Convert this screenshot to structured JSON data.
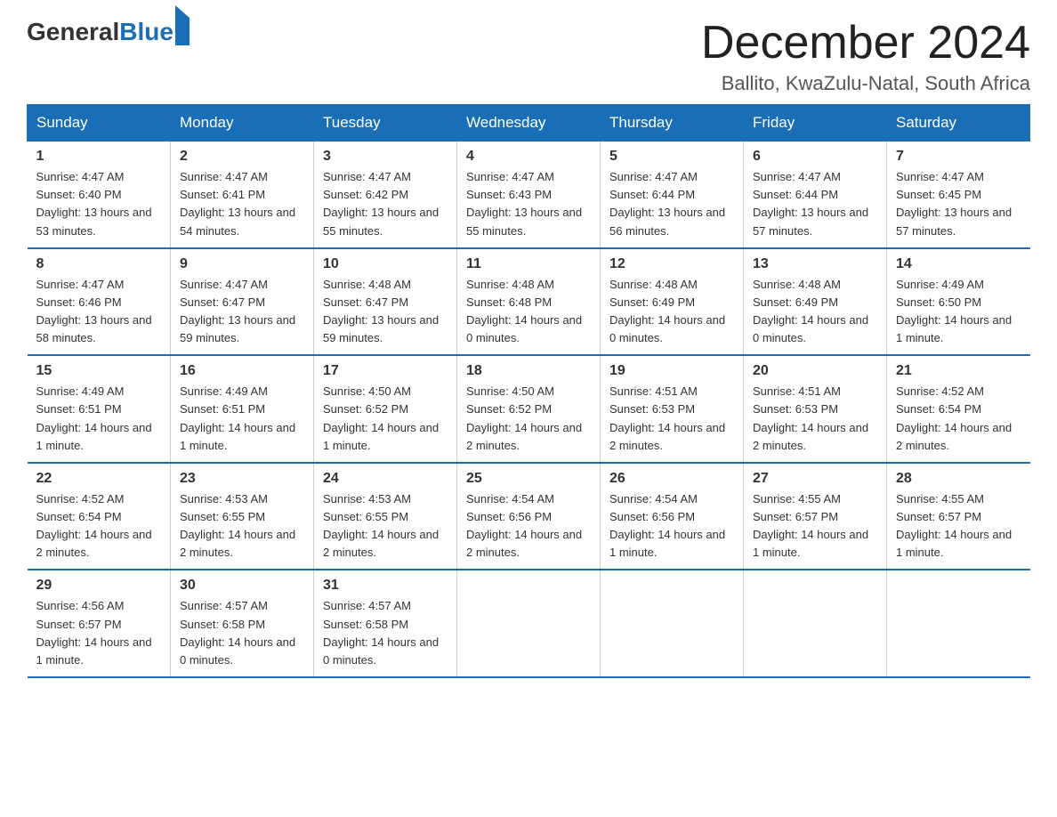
{
  "header": {
    "logo_general": "General",
    "logo_blue": "Blue",
    "month_title": "December 2024",
    "location": "Ballito, KwaZulu-Natal, South Africa"
  },
  "weekdays": [
    "Sunday",
    "Monday",
    "Tuesday",
    "Wednesday",
    "Thursday",
    "Friday",
    "Saturday"
  ],
  "weeks": [
    [
      {
        "day": "1",
        "sunrise": "4:47 AM",
        "sunset": "6:40 PM",
        "daylight": "13 hours and 53 minutes."
      },
      {
        "day": "2",
        "sunrise": "4:47 AM",
        "sunset": "6:41 PM",
        "daylight": "13 hours and 54 minutes."
      },
      {
        "day": "3",
        "sunrise": "4:47 AM",
        "sunset": "6:42 PM",
        "daylight": "13 hours and 55 minutes."
      },
      {
        "day": "4",
        "sunrise": "4:47 AM",
        "sunset": "6:43 PM",
        "daylight": "13 hours and 55 minutes."
      },
      {
        "day": "5",
        "sunrise": "4:47 AM",
        "sunset": "6:44 PM",
        "daylight": "13 hours and 56 minutes."
      },
      {
        "day": "6",
        "sunrise": "4:47 AM",
        "sunset": "6:44 PM",
        "daylight": "13 hours and 57 minutes."
      },
      {
        "day": "7",
        "sunrise": "4:47 AM",
        "sunset": "6:45 PM",
        "daylight": "13 hours and 57 minutes."
      }
    ],
    [
      {
        "day": "8",
        "sunrise": "4:47 AM",
        "sunset": "6:46 PM",
        "daylight": "13 hours and 58 minutes."
      },
      {
        "day": "9",
        "sunrise": "4:47 AM",
        "sunset": "6:47 PM",
        "daylight": "13 hours and 59 minutes."
      },
      {
        "day": "10",
        "sunrise": "4:48 AM",
        "sunset": "6:47 PM",
        "daylight": "13 hours and 59 minutes."
      },
      {
        "day": "11",
        "sunrise": "4:48 AM",
        "sunset": "6:48 PM",
        "daylight": "14 hours and 0 minutes."
      },
      {
        "day": "12",
        "sunrise": "4:48 AM",
        "sunset": "6:49 PM",
        "daylight": "14 hours and 0 minutes."
      },
      {
        "day": "13",
        "sunrise": "4:48 AM",
        "sunset": "6:49 PM",
        "daylight": "14 hours and 0 minutes."
      },
      {
        "day": "14",
        "sunrise": "4:49 AM",
        "sunset": "6:50 PM",
        "daylight": "14 hours and 1 minute."
      }
    ],
    [
      {
        "day": "15",
        "sunrise": "4:49 AM",
        "sunset": "6:51 PM",
        "daylight": "14 hours and 1 minute."
      },
      {
        "day": "16",
        "sunrise": "4:49 AM",
        "sunset": "6:51 PM",
        "daylight": "14 hours and 1 minute."
      },
      {
        "day": "17",
        "sunrise": "4:50 AM",
        "sunset": "6:52 PM",
        "daylight": "14 hours and 1 minute."
      },
      {
        "day": "18",
        "sunrise": "4:50 AM",
        "sunset": "6:52 PM",
        "daylight": "14 hours and 2 minutes."
      },
      {
        "day": "19",
        "sunrise": "4:51 AM",
        "sunset": "6:53 PM",
        "daylight": "14 hours and 2 minutes."
      },
      {
        "day": "20",
        "sunrise": "4:51 AM",
        "sunset": "6:53 PM",
        "daylight": "14 hours and 2 minutes."
      },
      {
        "day": "21",
        "sunrise": "4:52 AM",
        "sunset": "6:54 PM",
        "daylight": "14 hours and 2 minutes."
      }
    ],
    [
      {
        "day": "22",
        "sunrise": "4:52 AM",
        "sunset": "6:54 PM",
        "daylight": "14 hours and 2 minutes."
      },
      {
        "day": "23",
        "sunrise": "4:53 AM",
        "sunset": "6:55 PM",
        "daylight": "14 hours and 2 minutes."
      },
      {
        "day": "24",
        "sunrise": "4:53 AM",
        "sunset": "6:55 PM",
        "daylight": "14 hours and 2 minutes."
      },
      {
        "day": "25",
        "sunrise": "4:54 AM",
        "sunset": "6:56 PM",
        "daylight": "14 hours and 2 minutes."
      },
      {
        "day": "26",
        "sunrise": "4:54 AM",
        "sunset": "6:56 PM",
        "daylight": "14 hours and 1 minute."
      },
      {
        "day": "27",
        "sunrise": "4:55 AM",
        "sunset": "6:57 PM",
        "daylight": "14 hours and 1 minute."
      },
      {
        "day": "28",
        "sunrise": "4:55 AM",
        "sunset": "6:57 PM",
        "daylight": "14 hours and 1 minute."
      }
    ],
    [
      {
        "day": "29",
        "sunrise": "4:56 AM",
        "sunset": "6:57 PM",
        "daylight": "14 hours and 1 minute."
      },
      {
        "day": "30",
        "sunrise": "4:57 AM",
        "sunset": "6:58 PM",
        "daylight": "14 hours and 0 minutes."
      },
      {
        "day": "31",
        "sunrise": "4:57 AM",
        "sunset": "6:58 PM",
        "daylight": "14 hours and 0 minutes."
      },
      null,
      null,
      null,
      null
    ]
  ]
}
